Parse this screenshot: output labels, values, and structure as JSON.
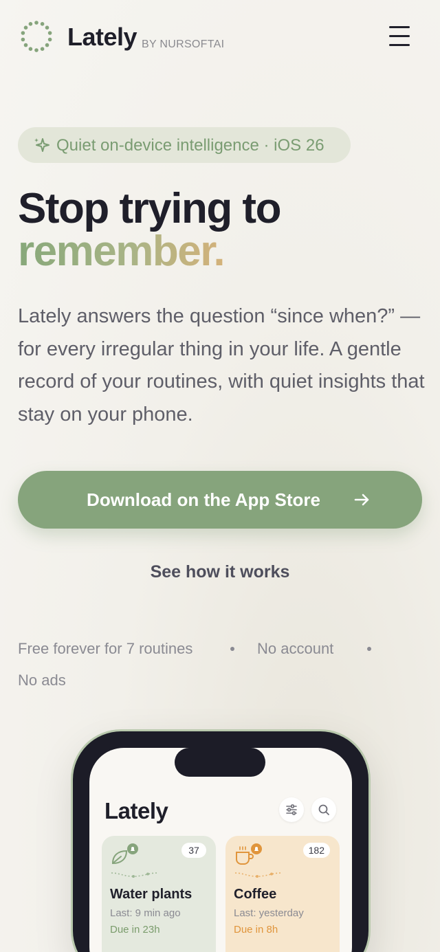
{
  "header": {
    "brand": "Lately",
    "byline": "BY NURSOFTAI",
    "logo_icon": "dotted-ring-icon",
    "menu_icon": "hamburger-menu-icon"
  },
  "hero": {
    "pill_icon": "sparkles-icon",
    "pill_text": "Quiet on-device intelligence · iOS 26",
    "headline_line1": "Stop trying to",
    "headline_line2": "remember.",
    "lead": "Lately answers the question “since when?” — for every irregular thing in your life. A gentle record of your routines, with quiet insights that stay on your phone.",
    "cta_label": "Download on the App Store",
    "cta_icon": "arrow-right-icon",
    "secondary_link": "See how it works"
  },
  "meta": {
    "items": [
      "Free forever for 7 routines",
      "No account",
      "No ads"
    ]
  },
  "phone_preview": {
    "app_title": "Lately",
    "filter_icon": "sliders-icon",
    "search_icon": "search-icon",
    "cards": [
      {
        "name": "Water plants",
        "count": "37",
        "last": "Last: 9 min ago",
        "due": "Due in 23h",
        "icon": "leaf-icon"
      },
      {
        "name": "Coffee",
        "count": "182",
        "last": "Last: yesterday",
        "due": "Due in 8h",
        "icon": "coffee-cup-icon"
      }
    ]
  },
  "colors": {
    "accent_green": "#86a47c",
    "headline_dark": "#1f1f2a",
    "gradient_start": "#87a87a",
    "gradient_end": "#d4b27a",
    "due_orange": "#e0953c"
  }
}
